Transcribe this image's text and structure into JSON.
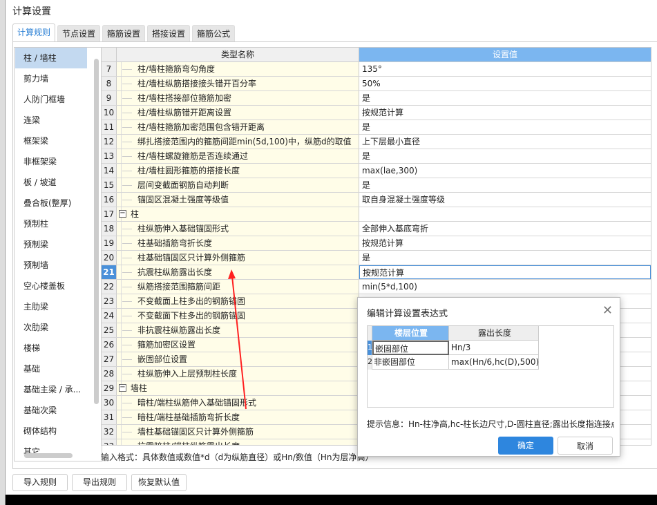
{
  "window": {
    "title": "计算设置"
  },
  "tabs": [
    "计算规则",
    "节点设置",
    "箍筋设置",
    "搭接设置",
    "箍筋公式"
  ],
  "sidebar": {
    "items": [
      "柱 / 墙柱",
      "剪力墙",
      "人防门框墙",
      "连梁",
      "框架梁",
      "非框架梁",
      "板 / 坡道",
      "叠合板(整厚)",
      "预制柱",
      "预制梁",
      "预制墙",
      "空心楼盖板",
      "主肋梁",
      "次肋梁",
      "楼梯",
      "基础",
      "基础主梁 / 承...",
      "基础次梁",
      "砌体结构",
      "其它"
    ],
    "selected": 0
  },
  "grid": {
    "headers": [
      "类型名称",
      "设置值"
    ],
    "rows": [
      {
        "n": "7",
        "name": "柱/墙柱箍筋弯勾角度",
        "value": "135°"
      },
      {
        "n": "8",
        "name": "柱/墙柱纵筋搭接接头错开百分率",
        "value": "50%"
      },
      {
        "n": "9",
        "name": "柱/墙柱搭接部位箍筋加密",
        "value": "是"
      },
      {
        "n": "10",
        "name": "柱/墙柱纵筋错开距离设置",
        "value": "按规范计算"
      },
      {
        "n": "11",
        "name": "柱/墙柱箍筋加密范围包含错开距离",
        "value": "是"
      },
      {
        "n": "12",
        "name": "绑扎搭接范围内的箍筋间距min(5d,100)中，纵筋d的取值",
        "value": "上下层最小直径"
      },
      {
        "n": "13",
        "name": "柱/墙柱螺旋箍筋是否连续通过",
        "value": "是"
      },
      {
        "n": "14",
        "name": "柱/墙柱圆形箍筋的搭接长度",
        "value": "max(lae,300)"
      },
      {
        "n": "15",
        "name": "层间变截面钢筋自动判断",
        "value": "是"
      },
      {
        "n": "16",
        "name": "锚固区混凝土强度等级值",
        "value": "取自身混凝土强度等级"
      },
      {
        "n": "17",
        "name": "柱",
        "value": "",
        "group": true
      },
      {
        "n": "18",
        "name": "柱纵筋伸入基础锚固形式",
        "value": "全部伸入基底弯折"
      },
      {
        "n": "19",
        "name": "柱基础插筋弯折长度",
        "value": "按规范计算"
      },
      {
        "n": "20",
        "name": "柱基础锚固区只计算外侧箍筋",
        "value": "是"
      },
      {
        "n": "21",
        "name": "抗震柱纵筋露出长度",
        "value": "按规范计算",
        "active": true
      },
      {
        "n": "22",
        "name": "纵筋搭接范围箍筋间距",
        "value": "min(5*d,100)"
      },
      {
        "n": "23",
        "name": "不变截面上柱多出的钢筋锚固",
        "value": ""
      },
      {
        "n": "24",
        "name": "不变截面下柱多出的钢筋锚固",
        "value": ""
      },
      {
        "n": "25",
        "name": "非抗震柱纵筋露出长度",
        "value": ""
      },
      {
        "n": "26",
        "name": "箍筋加密区设置",
        "value": ""
      },
      {
        "n": "27",
        "name": "嵌固部位设置",
        "value": ""
      },
      {
        "n": "28",
        "name": "柱纵筋伸入上层预制柱长度",
        "value": ""
      },
      {
        "n": "29",
        "name": "墙柱",
        "value": "",
        "group": true
      },
      {
        "n": "30",
        "name": "暗柱/端柱纵筋伸入基础锚固形式",
        "value": ""
      },
      {
        "n": "31",
        "name": "暗柱/端柱基础插筋弯折长度",
        "value": ""
      },
      {
        "n": "32",
        "name": "墙柱基础锚固区只计算外侧箍筋",
        "value": ""
      },
      {
        "n": "33",
        "name": "抗震暗柱/端柱纵筋露出长度",
        "value": ""
      }
    ]
  },
  "input_format": "输入格式：具体数值或数值*d（d为纵筋直径）或Hn/数值（Hn为层净高）",
  "buttons": {
    "import": "导入规则",
    "export": "导出规则",
    "restore": "恢复默认值"
  },
  "modal": {
    "title": "编辑计算设置表达式",
    "headers": [
      "楼层位置",
      "露出长度"
    ],
    "rows": [
      {
        "n": "1",
        "pos": "嵌固部位",
        "len": "Hn/3"
      },
      {
        "n": "2",
        "pos": "非嵌固部位",
        "len": "max(Hn/6,hc(D),500)"
      }
    ],
    "hint": "提示信息：Hn-柱净高,hc-柱长边尺寸,D-圆柱直径;露出长度指连接点",
    "ok": "确定",
    "cancel": "取消"
  },
  "colors": {
    "accent": "#2e86de",
    "annotation_arrow": "#ff2020"
  }
}
